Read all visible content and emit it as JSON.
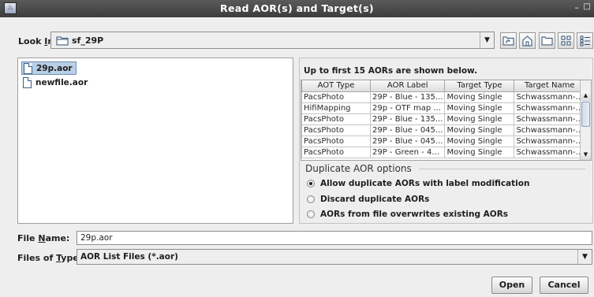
{
  "window": {
    "title": "Read AOR(s) and Target(s)",
    "minimize_glyph": "–",
    "maximize_glyph": "□",
    "app_icon": "java-app-icon"
  },
  "look_in": {
    "label_pre": "Look ",
    "label_mnemonic": "I",
    "label_post": "n:",
    "value": "sf_29P",
    "icon": "folder-icon"
  },
  "toolbar": {
    "buttons": [
      "up-one-level-icon",
      "home-icon",
      "new-folder-icon",
      "list-view-icon",
      "details-view-icon"
    ]
  },
  "files": [
    {
      "name": "29p.aor",
      "selected": true
    },
    {
      "name": "newfile.aor",
      "selected": false
    }
  ],
  "aor_panel": {
    "note": "Up to first 15 AORs are shown below.",
    "columns": [
      "AOT Type",
      "AOR Label",
      "Target Type",
      "Target Name"
    ],
    "rows": [
      [
        "PacsPhoto",
        "29P - Blue - 135...",
        "Moving Single",
        "Schwassmann-..."
      ],
      [
        "HifiMapping",
        "29p - OTF map ...",
        "Moving Single",
        "Schwassmann-..."
      ],
      [
        "PacsPhoto",
        "29P - Blue - 135...",
        "Moving Single",
        "Schwassmann-..."
      ],
      [
        "PacsPhoto",
        "29P - Blue - 045...",
        "Moving Single",
        "Schwassmann-..."
      ],
      [
        "PacsPhoto",
        "29P - Blue - 045...",
        "Moving Single",
        "Schwassmann-..."
      ],
      [
        "PacsPhoto",
        "29P - Green - 4...",
        "Moving Single",
        "Schwassmann-..."
      ]
    ],
    "scroll_up_glyph": "▲",
    "scroll_down_glyph": "▼"
  },
  "duplicate_options": {
    "title": "Duplicate AOR options",
    "options": [
      {
        "label": "Allow duplicate AORs with label modification",
        "selected": true
      },
      {
        "label": "Discard duplicate AORs",
        "selected": false
      },
      {
        "label": "AORs from file overwrites existing AORs",
        "selected": false
      }
    ]
  },
  "file_name": {
    "label_pre": "File ",
    "label_mnemonic": "N",
    "label_post": "ame:",
    "value": "29p.aor"
  },
  "file_type": {
    "label_pre": "Files of ",
    "label_mnemonic": "T",
    "label_post": "ype:",
    "value": "AOR List Files (*.aor)"
  },
  "buttons": {
    "open": "Open",
    "cancel": "Cancel"
  },
  "dropdown_glyph": "▼",
  "colors": {
    "titlebar": "#4a4a4a",
    "selection": "#b8cfe5",
    "background": "#eeeeee"
  }
}
